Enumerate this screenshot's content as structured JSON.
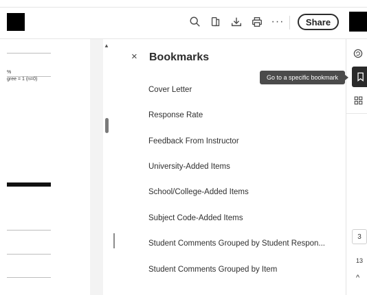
{
  "toolbar": {
    "icons": [
      "search-icon",
      "page-layout-icon",
      "download-icon",
      "print-icon",
      "more-icon"
    ],
    "more_label": "···",
    "share_label": "Share"
  },
  "document": {
    "fragment_percent": "%",
    "fragment_scale": "gree = 1 (n=0)"
  },
  "bookmarks_panel": {
    "close_label": "×",
    "title": "Bookmarks",
    "items": [
      {
        "label": "Cover Letter"
      },
      {
        "label": "Response Rate"
      },
      {
        "label": "Feedback From Instructor"
      },
      {
        "label": "University-Added Items"
      },
      {
        "label": "School/College-Added Items"
      },
      {
        "label": "Subject Code-Added Items"
      },
      {
        "label": "Student Comments Grouped by Student Respon..."
      },
      {
        "label": "Student Comments Grouped by Item"
      }
    ]
  },
  "right_rail": {
    "icons": [
      "comment-icon",
      "bookmark-icon",
      "thumbnails-icon"
    ],
    "tooltip": "Go to a specific bookmark",
    "current_page": "3",
    "total_pages": "13",
    "page_up_label": "^"
  }
}
